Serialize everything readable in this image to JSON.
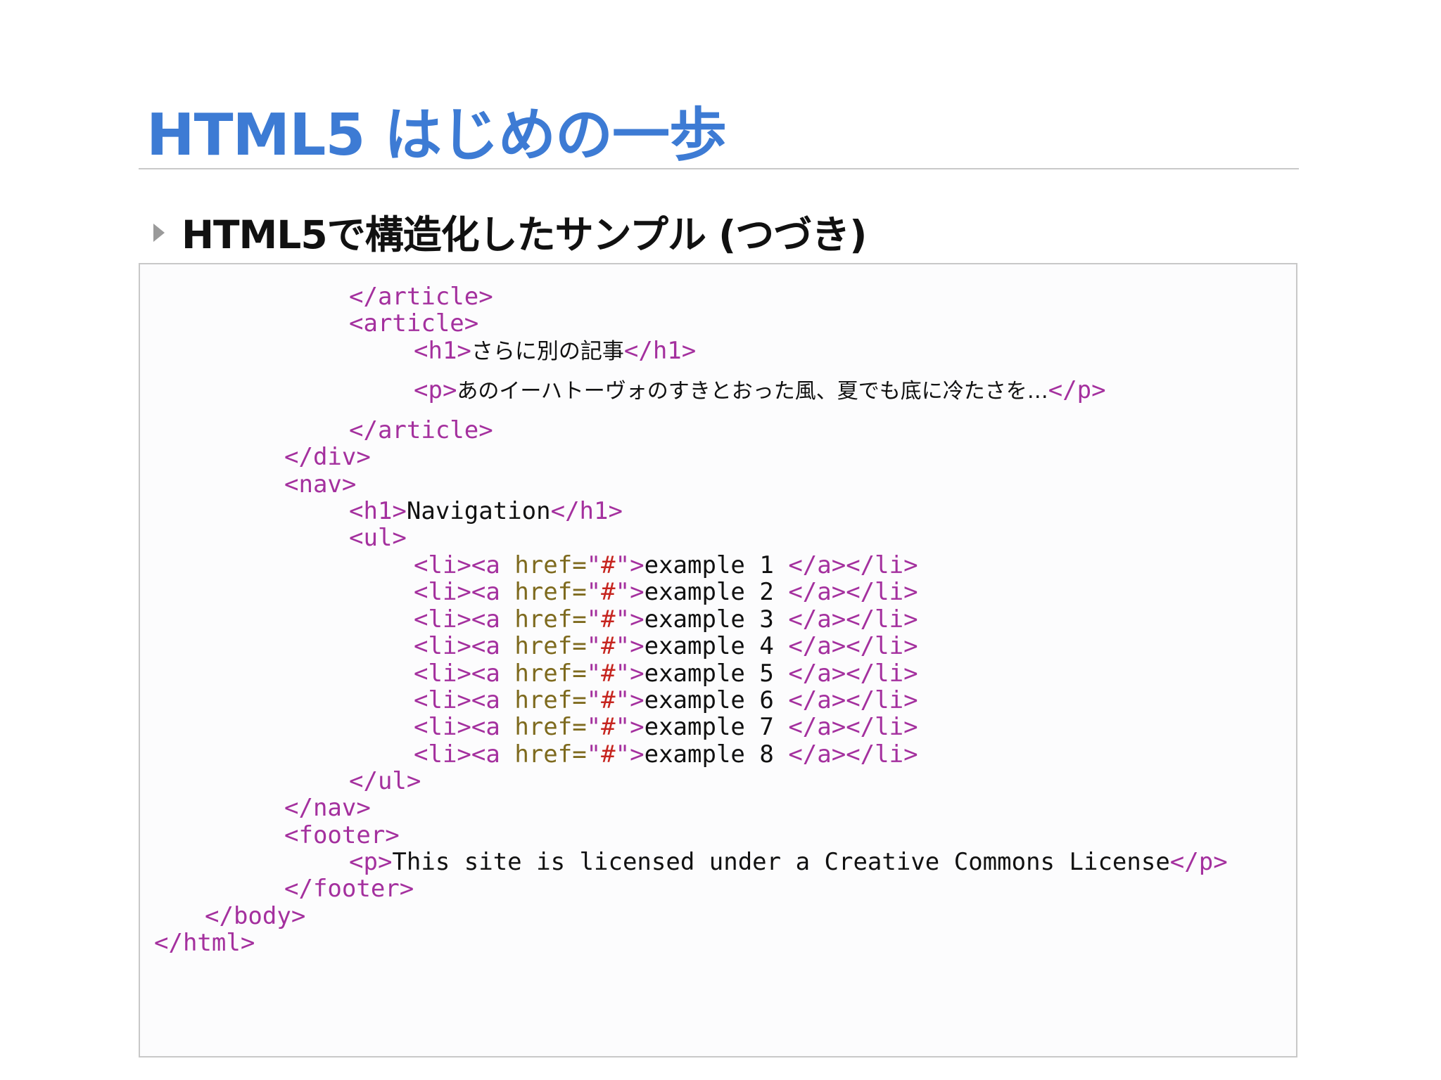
{
  "slide": {
    "title": "HTML5 はじめの一歩",
    "subtitle": "HTML5で構造化したサンプル (つづき)"
  },
  "code": {
    "close_article": "</article>",
    "open_article": "<article>",
    "h1_open": "<h1>",
    "h1_text": "さらに別の記事",
    "h1_close": "</h1>",
    "p_open": "<p>",
    "p_text": "あのイーハトーヴォのすきとおった風、夏でも底に冷たさを…",
    "p_close": "</p>",
    "close_div": "</div>",
    "open_nav": "<nav>",
    "nav_h1_text": "Navigation",
    "open_ul": "<ul>",
    "li_a_open": "<li><a",
    "href_attr": "href=",
    "href_quote": "\"",
    "href_value": "#",
    "gt": ">",
    "a_li_close": "</a></li>",
    "list_items": [
      "example 1 ",
      "example 2 ",
      "example 3 ",
      "example 4 ",
      "example 5 ",
      "example 6 ",
      "example 7 ",
      "example 8 "
    ],
    "close_ul": "</ul>",
    "close_nav": "</nav>",
    "open_footer": "<footer>",
    "footer_text": "This site is licensed under a Creative Commons License",
    "close_footer": "</footer>",
    "close_body": "</body>",
    "close_html": "</html>"
  }
}
